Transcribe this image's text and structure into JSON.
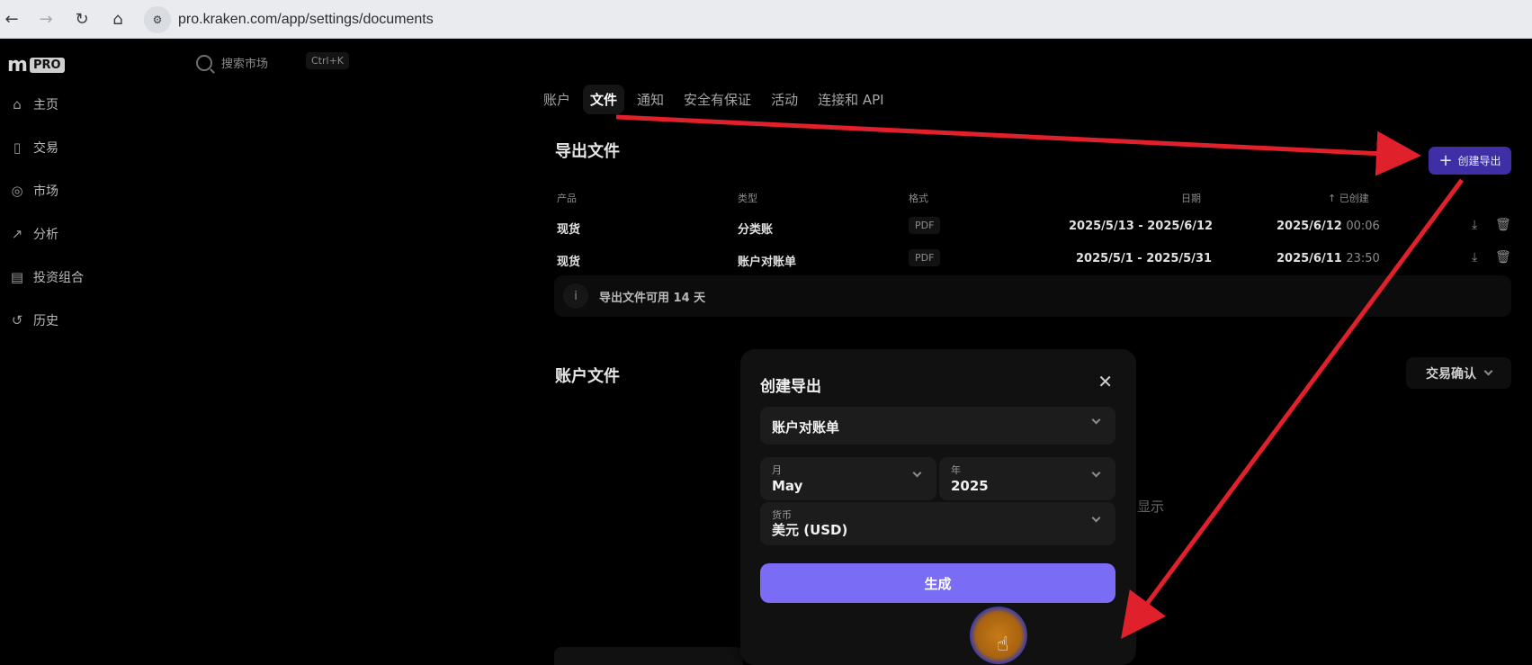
{
  "browser": {
    "url": "pro.kraken.com/app/settings/documents",
    "back_icon": "arrow-left-icon",
    "forward_icon": "arrow-right-icon",
    "reload_icon": "reload-icon",
    "home_icon": "home-icon"
  },
  "header": {
    "logo_text": "PRO",
    "search_placeholder": "搜索市场",
    "search_shortcut": "Ctrl+K"
  },
  "sidebar": {
    "items": [
      {
        "label": "主页",
        "icon": "home-icon"
      },
      {
        "label": "交易",
        "icon": "candles-icon"
      },
      {
        "label": "市场",
        "icon": "coins-icon"
      },
      {
        "label": "分析",
        "icon": "chart-icon"
      },
      {
        "label": "投资组合",
        "icon": "wallet-icon"
      },
      {
        "label": "历史",
        "icon": "history-icon"
      }
    ]
  },
  "tabs": [
    {
      "label": "账户",
      "active": false
    },
    {
      "label": "文件",
      "active": true
    },
    {
      "label": "通知",
      "active": false
    },
    {
      "label": "安全有保证",
      "active": false
    },
    {
      "label": "活动",
      "active": false
    },
    {
      "label": "连接和 API",
      "active": false
    }
  ],
  "exports": {
    "title": "导出文件",
    "create_button": "创建导出",
    "columns": {
      "product": "产品",
      "type": "类型",
      "format": "格式",
      "date": "日期",
      "created": "已创建"
    },
    "rows": [
      {
        "product": "现货",
        "type": "分类账",
        "format": "PDF",
        "date": "2025/5/13 - 2025/6/12",
        "created_date": "2025/6/12",
        "created_time": "00:06"
      },
      {
        "product": "现货",
        "type": "账户对账单",
        "format": "PDF",
        "date": "2025/5/1 - 2025/5/31",
        "created_date": "2025/6/11",
        "created_time": "23:50"
      }
    ],
    "info": "导出文件可用 14 天"
  },
  "account_docs": {
    "title": "账户文件",
    "filter_value": "交易确认",
    "partial_text": "显示"
  },
  "modal": {
    "title": "创建导出",
    "doc_type": "账户对账单",
    "month_label": "月",
    "month_value": "May",
    "year_label": "年",
    "year_value": "2025",
    "currency_label": "货币",
    "currency_value": "美元 (USD)",
    "generate_label": "生成"
  },
  "colors": {
    "accent": "#7b6cf6",
    "create_button": "#3f2fa6",
    "arrow": "#e0202a"
  }
}
